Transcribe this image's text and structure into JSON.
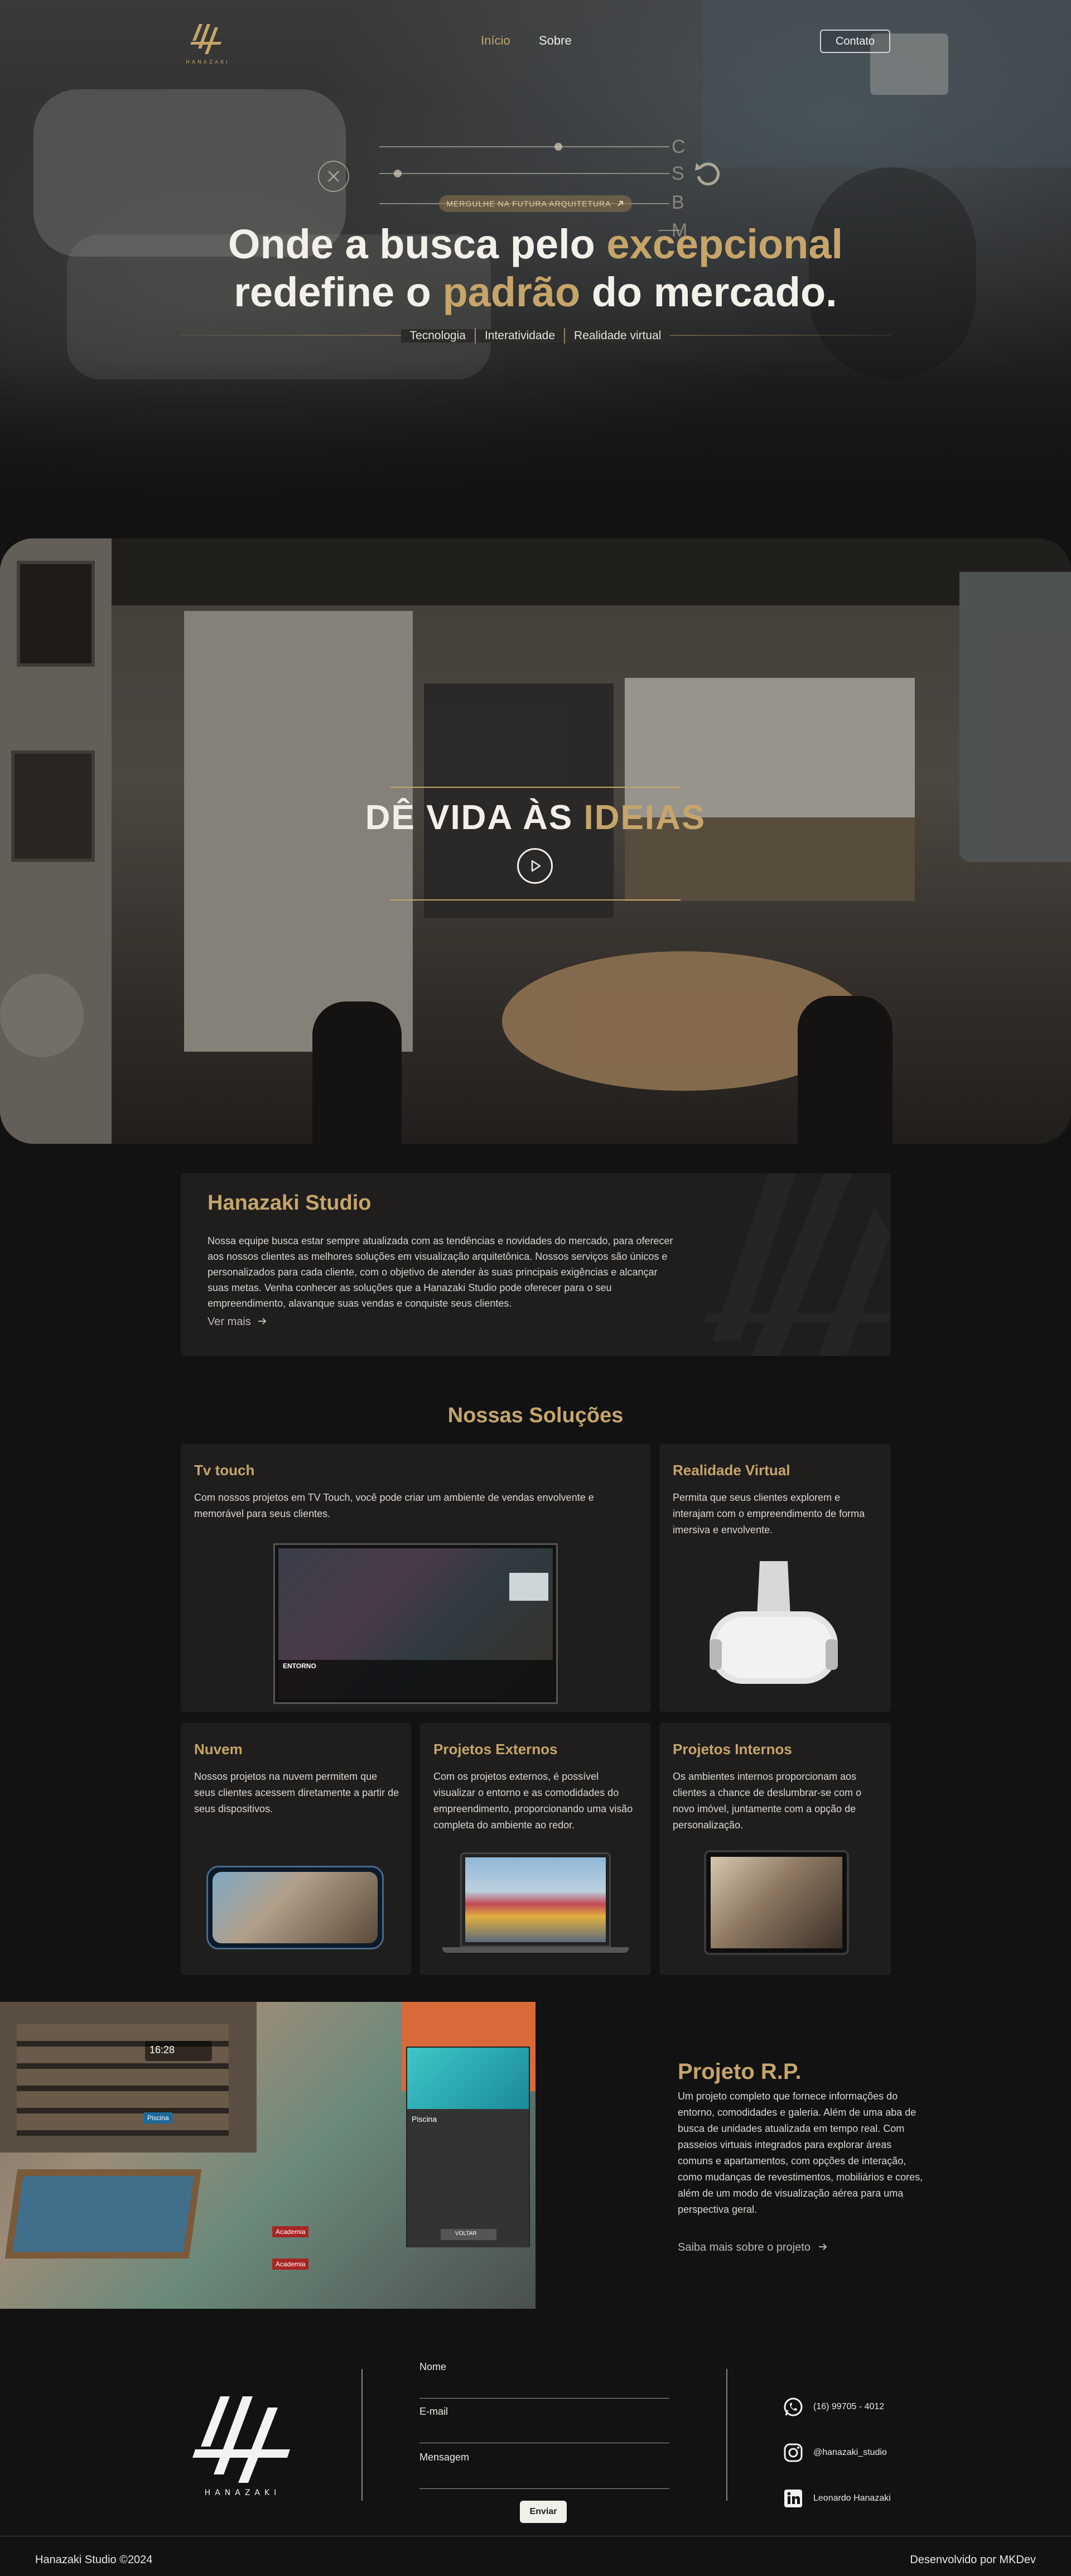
{
  "nav": {
    "logo_text": "HANAZAKI",
    "home_label": "Início",
    "about_label": "Sobre",
    "contact_label": "Contato"
  },
  "hero": {
    "slider_letters": [
      "C",
      "S",
      "B",
      "M"
    ],
    "pill_label": "MERGULHE NA FUTURA ARQUITETURA",
    "headline_1a": "Onde a busca pelo ",
    "headline_1b": "excepcional",
    "headline_2a": "redefine o ",
    "headline_2b": "padrão",
    "headline_2c": " do mercado.",
    "tags": [
      "Tecnologia",
      "Interatividade",
      "Realidade virtual"
    ]
  },
  "video": {
    "title_a": "DÊ VIDA ÀS ",
    "title_b": "IDEIAS"
  },
  "studio": {
    "title": "Hanazaki Studio",
    "text": "Nossa equipe busca estar sempre atualizada com as tendências e novidades do mercado, para oferecer aos nossos clientes as melhores soluções em visualização arquitetônica. Nossos serviços são únicos e personalizados para cada cliente, com o objetivo de atender às suas principais exigências e alcançar suas metas. Venha conhecer as soluções que a Hanazaki Studio pode oferecer para o seu empreendimento, alavanque suas vendas e conquiste seus clientes.",
    "more_label": "Ver mais"
  },
  "solutions": {
    "title": "Nossas Soluções",
    "cards": [
      {
        "title": "Tv touch",
        "text": "Com nossos projetos em TV Touch, você pode criar um ambiente de vendas envolvente e memorável para seus clientes.",
        "screen_label": "ENTORNO"
      },
      {
        "title": "Realidade Virtual",
        "text": "Permita que seus clientes explorem e interajam com o empreendimento de forma imersiva e envolvente."
      },
      {
        "title": "Nuvem",
        "text": "Nossos projetos na nuvem permitem que seus clientes acessem diretamente a partir de seus dispositivos."
      },
      {
        "title": "Projetos Externos",
        "text": "Com os projetos externos, é possível visualizar o entorno e as comodidades do empreendimento, proporcionando uma visão completa do ambiente ao redor."
      },
      {
        "title": "Projetos Internos",
        "text": "Os ambientes internos proporcionam aos clientes a chance de deslumbrar-se com o novo imóvel, juntamente com a opção de personalização."
      }
    ]
  },
  "project": {
    "title": "Projeto R.P.",
    "text": "Um projeto completo que fornece informações do entorno, comodidades e galeria. Além de uma aba de busca de unidades atualizada em tempo real. Com passeios virtuais integrados para explorar áreas comuns e apartamentos, com opções de interação, como mudanças de revestimentos, mobiliários e cores, além de um modo de visualização aérea para uma perspectiva geral.",
    "link_label": "Saiba mais sobre o projeto",
    "image_time": "16:28",
    "image_popup_title": "Piscina",
    "image_popup_button": "VOLTAR",
    "image_tag_1": "Piscina",
    "image_tag_2": "Academia",
    "image_tag_3": "Academia"
  },
  "footer": {
    "logo_text": "HANAZAKI",
    "name_label": "Nome",
    "email_label": "E-mail",
    "message_label": "Mensagem",
    "send_label": "Enviar",
    "phone": "(16) 99705 - 4012",
    "instagram": "@hanazaki_studio",
    "linkedin": "Leonardo Hanazaki",
    "copyright": "Hanazaki Studio ©2024",
    "developer": "Desenvolvido por MKDev"
  },
  "colors": {
    "accent": "#c6a56a",
    "background": "#121212",
    "card": "#1f1e1d"
  },
  "icons": [
    "logo-mark-icon",
    "close-circle-icon",
    "rotate-icon",
    "arrow-up-right-icon",
    "play-icon",
    "arrow-right-icon",
    "whatsapp-icon",
    "instagram-icon",
    "linkedin-icon"
  ]
}
